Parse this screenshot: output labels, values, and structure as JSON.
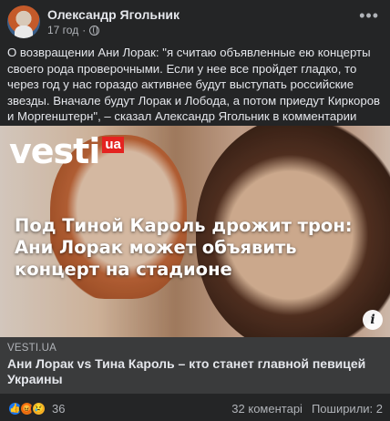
{
  "header": {
    "author": "Олександр Ягольник",
    "time": "17 год",
    "separator": "·",
    "privacy_icon": "globe-icon",
    "more_icon": "more-icon"
  },
  "post": {
    "text": "О возвращении Ани Лорак: \"я считаю объявленные ею концерты своего рода проверочными. Если у нее все пройдет гладко, то через год у нас гораздо активнее будут выступать российские звезды. Вначале будут Лорак и Лобода, а потом приедут Киркоров и Моргенштерн\", – сказал Александр Ягольник в комментарии Vesti.ua."
  },
  "link": {
    "image_logo": "vesti",
    "image_logo_badge": "ua",
    "image_headline": "Под Тиной Кароль дрожит трон: Ани Лорак может объявить концерт на стадионе",
    "domain": "VESTI.UA",
    "title": "Ани Лорак vs Тина Кароль – кто станет главной певицей Украины",
    "info_icon": "i"
  },
  "footer": {
    "reaction_count": "36",
    "comments": "32 коментарі",
    "shares": "Поширили: 2"
  },
  "colors": {
    "background": "#242526",
    "text": "#e4e6eb",
    "secondary": "#b0b3b8",
    "link_bg": "#3a3b3c",
    "like": "#1877f2",
    "angry": "#e9710f",
    "sad": "#f7b125",
    "brand_ua": "#e42320"
  }
}
